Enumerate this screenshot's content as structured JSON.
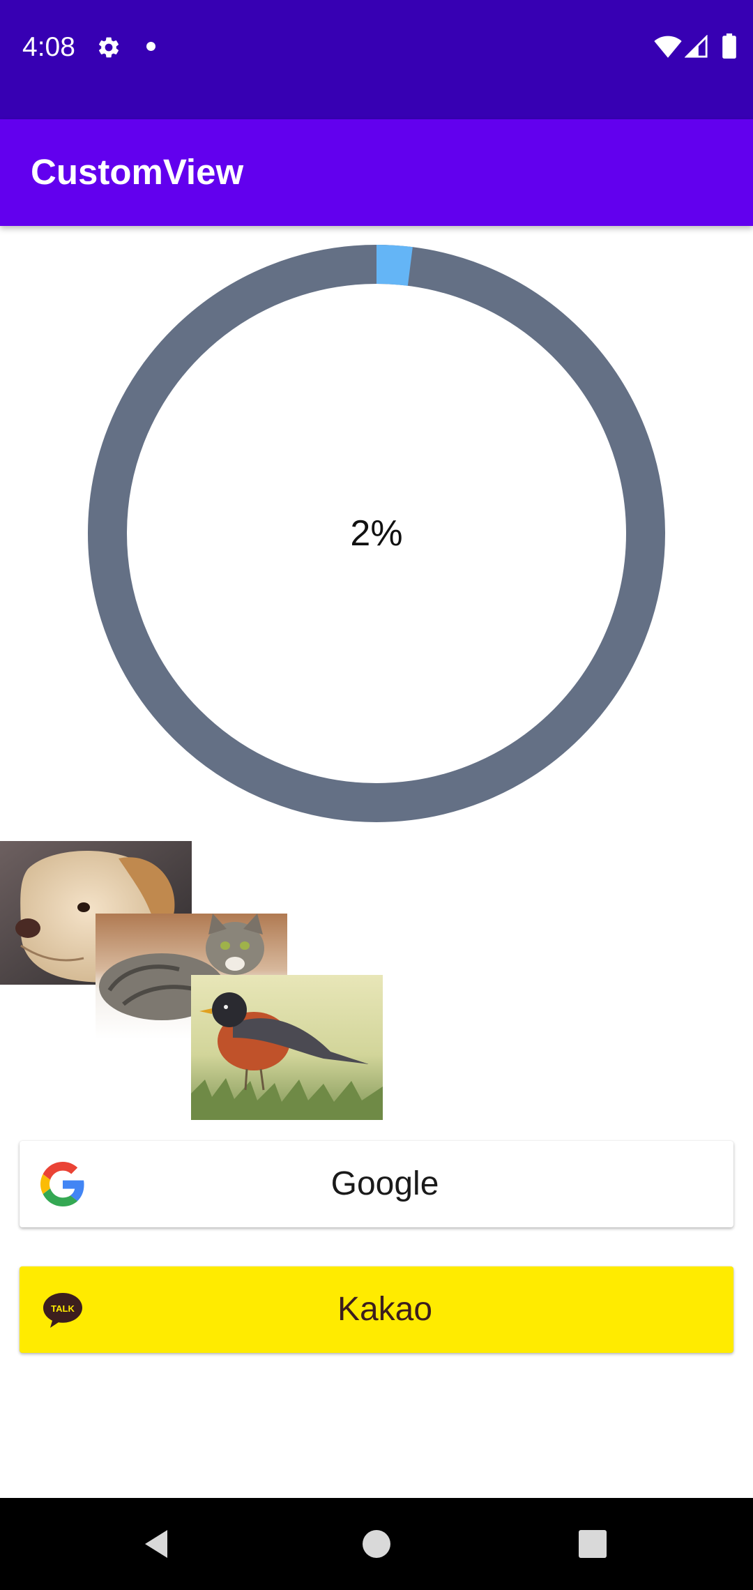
{
  "status_bar": {
    "time": "4:08",
    "icons": [
      "gear-icon",
      "notification-dot",
      "wifi-icon",
      "signal-icon",
      "battery-icon"
    ],
    "background": "#3700b3"
  },
  "app_bar": {
    "title": "CustomView",
    "background": "#6200ee"
  },
  "progress": {
    "label": "2%",
    "value_percent": 2,
    "track_color": "#647085",
    "progress_color": "#64b5f6"
  },
  "photos": [
    {
      "subject": "dog"
    },
    {
      "subject": "cat"
    },
    {
      "subject": "bird"
    }
  ],
  "buttons": {
    "google": {
      "label": "Google",
      "icon": "google-logo-icon",
      "background": "#ffffff"
    },
    "kakao": {
      "label": "Kakao",
      "icon": "kakao-talk-icon",
      "background": "#ffeb00"
    }
  },
  "nav_bar": {
    "items": [
      "back-icon",
      "home-icon",
      "recents-icon"
    ]
  }
}
